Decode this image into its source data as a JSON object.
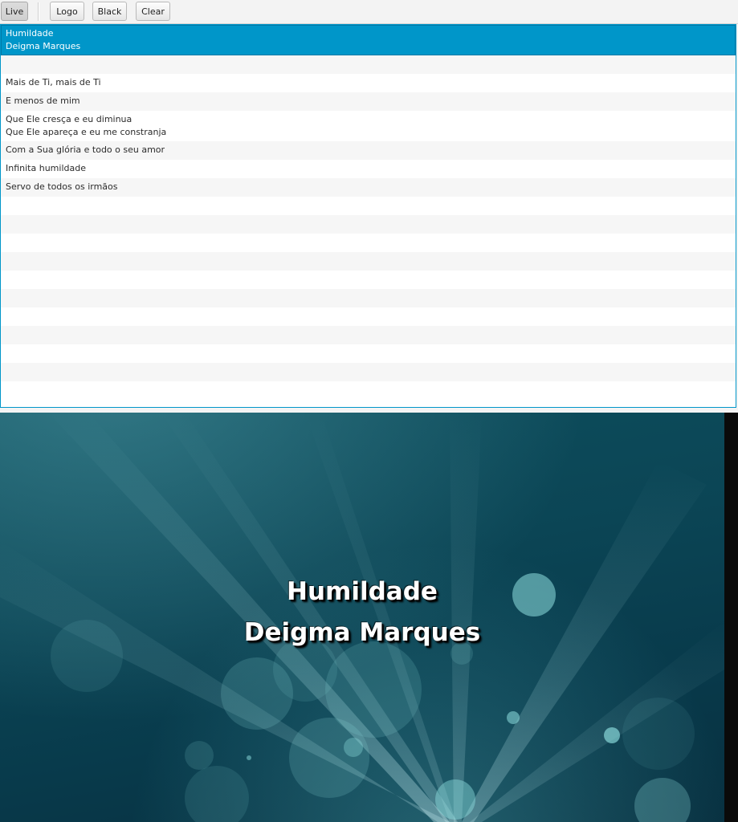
{
  "toolbar": {
    "live_label": "Live",
    "logo_label": "Logo",
    "black_label": "Black",
    "clear_label": "Clear"
  },
  "slides": [
    {
      "lines": [
        "Humildade",
        "Deigma Marques"
      ],
      "selected": true
    },
    {
      "lines": [
        ""
      ]
    },
    {
      "lines": [
        "Mais de Ti, mais de Ti"
      ]
    },
    {
      "lines": [
        "E menos de mim"
      ]
    },
    {
      "lines": [
        "Que Ele cresça e eu diminua",
        "Que Ele apareça e eu me constranja"
      ]
    },
    {
      "lines": [
        "Com a Sua glória e todo o seu amor"
      ]
    },
    {
      "lines": [
        "Infinita humildade"
      ]
    },
    {
      "lines": [
        "Servo de todos os irmãos"
      ]
    }
  ],
  "preview": {
    "line1": "Humildade",
    "line2": "Deigma Marques"
  },
  "colors": {
    "selection": "#0096c9",
    "preview_bg": "#0b4555"
  }
}
